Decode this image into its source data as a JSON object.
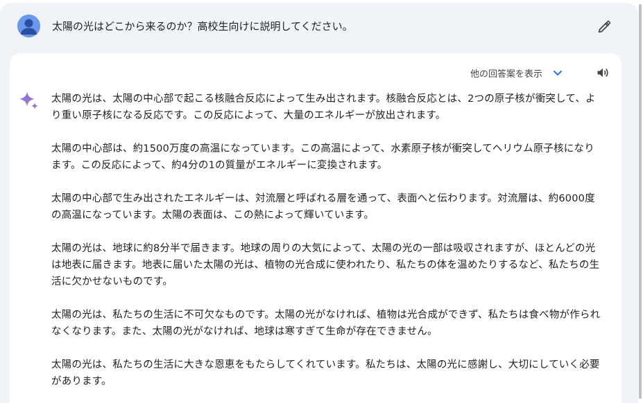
{
  "prompt": {
    "text": "太陽の光はどこから来るのか？高校生向けに説明してください。"
  },
  "response": {
    "drafts_label": "他の回答案を表示",
    "paragraphs": [
      "太陽の光は、太陽の中心部で起こる核融合反応によって生み出されます。核融合反応とは、2つの原子核が衝突して、より重い原子核になる反応です。この反応によって、大量のエネルギーが放出されます。",
      "太陽の中心部は、約1500万度の高温になっています。この高温によって、水素原子核が衝突してヘリウム原子核になります。この反応によって、約4分の1の質量がエネルギーに変換されます。",
      "太陽の中心部で生み出されたエネルギーは、対流層と呼ばれる層を通って、表面へと伝わります。対流層は、約6000度の高温になっています。太陽の表面は、この熱によって輝いています。",
      "太陽の光は、地球に約8分半で届きます。地球の周りの大気によって、太陽の光の一部は吸収されますが、ほとんどの光は地表に届きます。地表に届いた太陽の光は、植物の光合成に使われたり、私たちの体を温めたりするなど、私たちの生活に欠かせないものです。",
      "太陽の光は、私たちの生活に不可欠なものです。太陽の光がなければ、植物は光合成ができず、私たちは食べ物が作られなくなります。また、太陽の光がなければ、地球は寒すぎて生命が存在できません。",
      "太陽の光は、私たちの生活に大きな恩恵をもたらしてくれています。私たちは、太陽の光に感謝し、大切にしていく必要があります。"
    ]
  },
  "icons": {
    "avatar": "user-avatar-icon",
    "edit": "pencil-icon",
    "chevron": "chevron-down-icon",
    "speaker": "speaker-icon",
    "spark": "gemini-spark-icon"
  },
  "colors": {
    "background": "#f0f4f9",
    "card": "#ffffff",
    "accent": "#1a73e8",
    "avatar": "#5f8ce8"
  }
}
